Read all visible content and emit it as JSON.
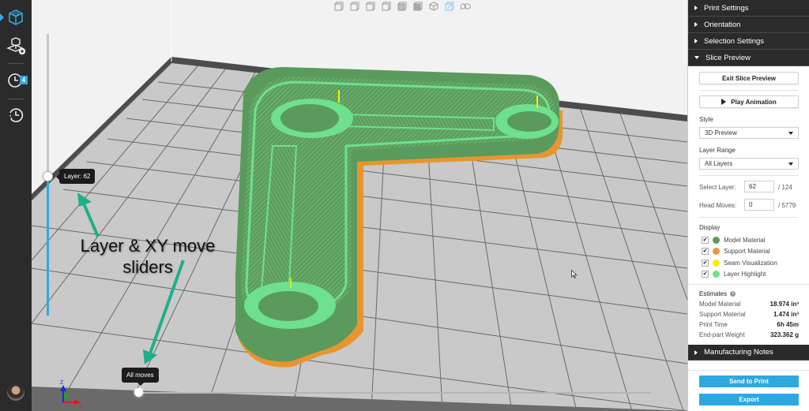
{
  "rail": {
    "items": [
      {
        "name": "prepare",
        "icon": "printer-cube-icon",
        "active": true
      },
      {
        "name": "add-model",
        "icon": "add-part-icon"
      },
      {
        "name": "job-queue",
        "icon": "clock-icon",
        "badge": "4"
      },
      {
        "name": "history",
        "icon": "history-icon"
      }
    ]
  },
  "viewport": {
    "view_toolbar": [
      "front-view",
      "back-view",
      "left-view",
      "right-view",
      "top-view",
      "bottom-view",
      "isometric-view",
      "perspective-view",
      "zoom-fit-view"
    ],
    "layer_slider": {
      "tooltip": "Layer: 62",
      "value": 62,
      "max": 124
    },
    "moves_slider": {
      "tooltip": "All moves",
      "value": 0,
      "max": 5779
    },
    "annotation": "Layer & XY move sliders",
    "axes": {
      "x": "X",
      "y": "Y",
      "z": "Z"
    },
    "colors": {
      "model": "#5e9c5e",
      "support": "#e8952f",
      "seam": "#f5f000",
      "highlight": "#6ee08e",
      "arrow": "#1fae8c",
      "accent": "#2fa8e0"
    }
  },
  "panel": {
    "sections": [
      {
        "label": "Print Settings",
        "expanded": false
      },
      {
        "label": "Orientation",
        "expanded": false
      },
      {
        "label": "Selection Settings",
        "expanded": false
      },
      {
        "label": "Slice Preview",
        "expanded": true
      }
    ],
    "exit_button": "Exit Slice Preview",
    "play_button": "Play Animation",
    "style_label": "Style",
    "style_value": "3D Preview",
    "layer_range_label": "Layer Range",
    "layer_range_value": "All Layers",
    "select_layer_label": "Select Layer:",
    "select_layer_value": "62",
    "select_layer_total": "/ 124",
    "head_moves_label": "Head Moves:",
    "head_moves_value": "0",
    "head_moves_total": "/ 5779",
    "display_label": "Display",
    "display_items": [
      {
        "label": "Model Material",
        "checked": true,
        "color": "#5e9c5e"
      },
      {
        "label": "Support Material",
        "checked": true,
        "color": "#f0953a"
      },
      {
        "label": "Seam Visualization",
        "checked": true,
        "color": "#f5f000"
      },
      {
        "label": "Layer Highlight",
        "checked": true,
        "color": "#6ee08e"
      }
    ],
    "estimates_label": "Estimates",
    "estimates": [
      {
        "label": "Model Material",
        "value": "18.974 in³"
      },
      {
        "label": "Support Material",
        "value": "1.474 in³"
      },
      {
        "label": "Print Time",
        "value": "6h 45m"
      },
      {
        "label": "End-part Weight",
        "value": "323.362 g"
      }
    ],
    "manufacturing_notes": "Manufacturing Notes",
    "send_button": "Send to Print",
    "export_button": "Export"
  }
}
